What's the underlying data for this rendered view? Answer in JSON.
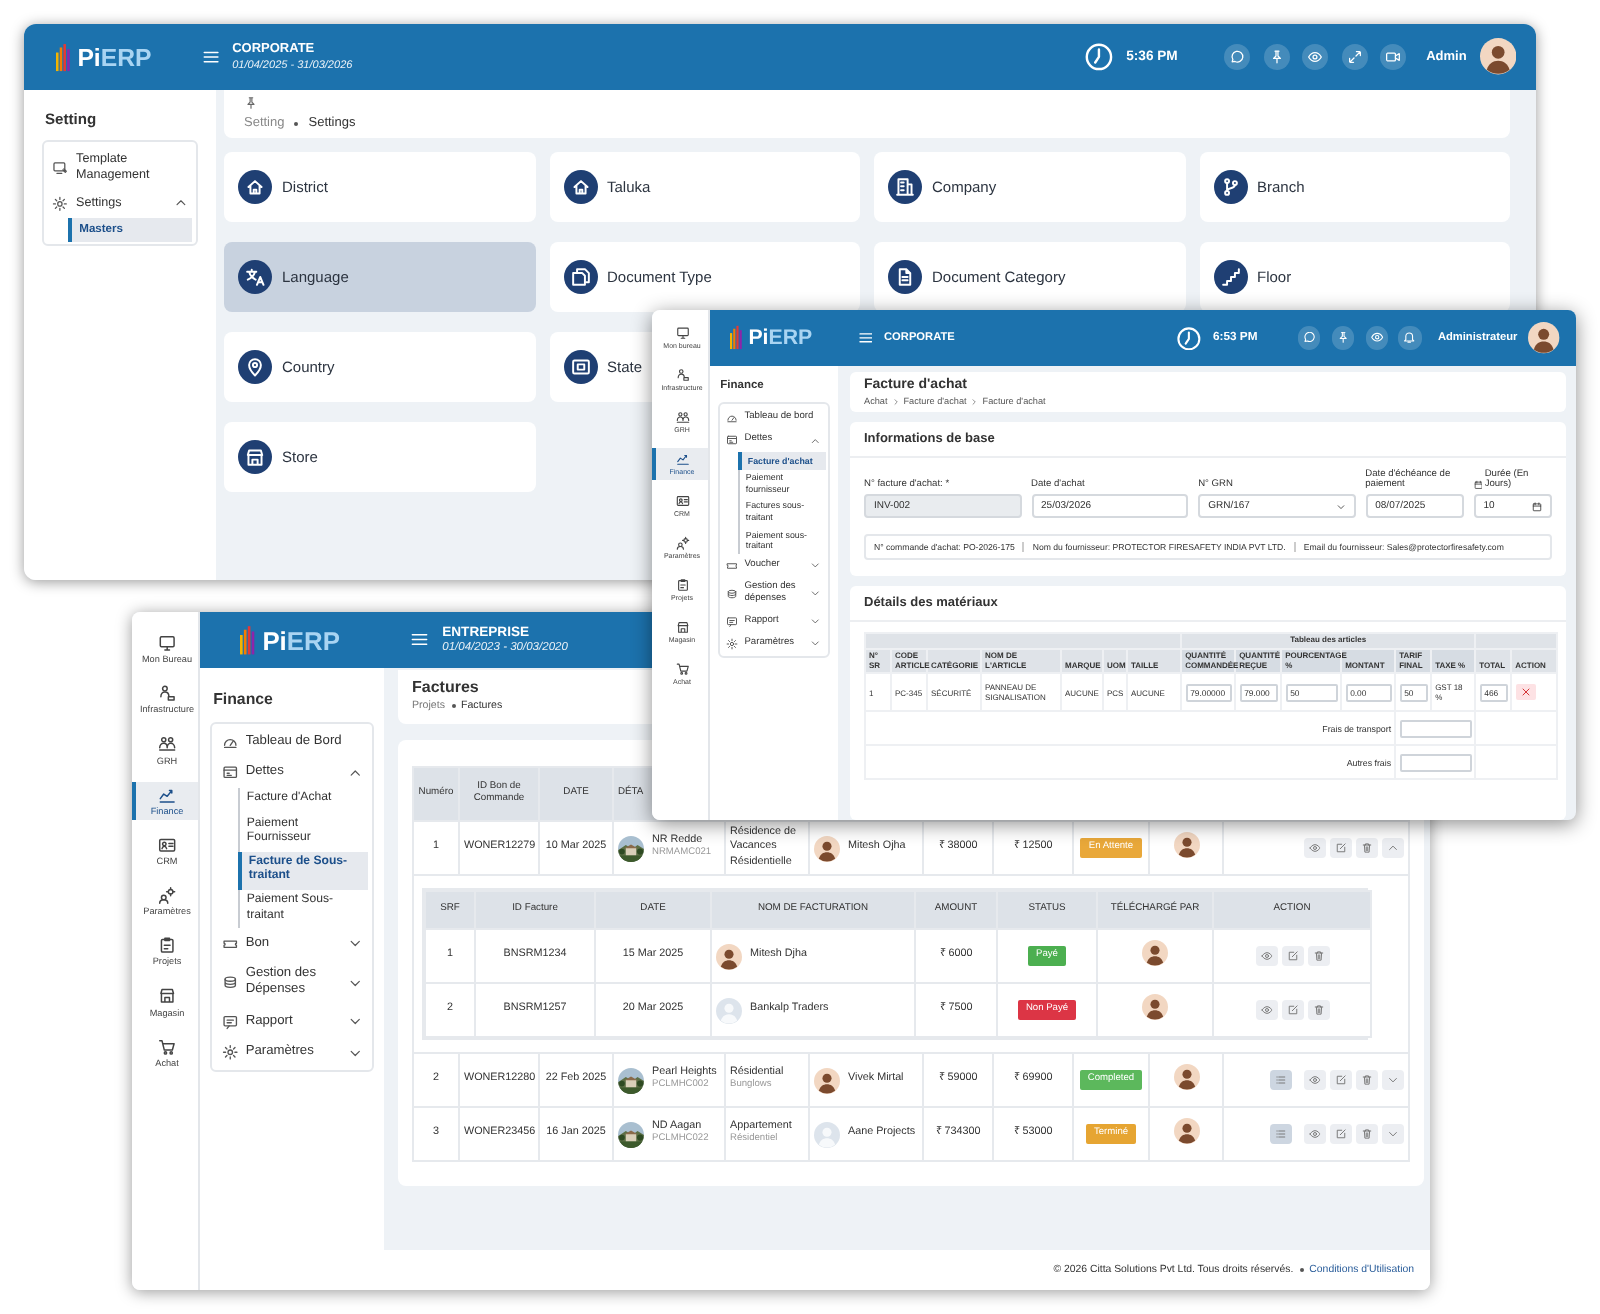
{
  "settings_window": {
    "header": {
      "brand_prefix": "Pi",
      "brand_suffix": "ERP",
      "company": "CORPORATE",
      "period": "01/04/2025 - 31/03/2026",
      "time": "5:36 PM",
      "user": "Admin"
    },
    "sidebar": {
      "title": "Setting",
      "items": [
        {
          "kind": "link",
          "label": "Template Management"
        },
        {
          "kind": "group",
          "label": "Settings",
          "expanded": true,
          "children": [
            {
              "label": "Masters",
              "selected": true
            }
          ]
        }
      ]
    },
    "breadcrumb": [
      "Setting",
      "Settings"
    ],
    "tile_rows": [
      [
        {
          "label": "District",
          "selected": false
        },
        {
          "label": "Taluka",
          "selected": false
        },
        {
          "label": "Company",
          "selected": false
        },
        {
          "label": "Branch",
          "selected": false
        }
      ],
      [
        {
          "label": "Language",
          "selected": true
        },
        {
          "label": "Document Type",
          "selected": false
        },
        {
          "label": "Document Category",
          "selected": false
        },
        {
          "label": "Floor",
          "selected": false
        }
      ],
      [
        {
          "label": "Country",
          "selected": false
        },
        {
          "label": "State",
          "selected": false
        }
      ],
      [
        {
          "label": "Store",
          "selected": false
        }
      ]
    ]
  },
  "purchase_window": {
    "rail": [
      {
        "label": "Mon bureau",
        "selected": false
      },
      {
        "label": "Infrastructure",
        "selected": false
      },
      {
        "label": "GRH",
        "selected": false
      },
      {
        "label": "Finance",
        "selected": true
      },
      {
        "label": "CRM",
        "selected": false
      },
      {
        "label": "Paramètres",
        "selected": false
      },
      {
        "label": "Projets",
        "selected": false
      },
      {
        "label": "Magasin",
        "selected": false
      },
      {
        "label": "Achat",
        "selected": false
      }
    ],
    "header": {
      "brand_prefix": "Pi",
      "brand_suffix": "ERP",
      "company": "CORPORATE",
      "time": "6:53 PM",
      "user": "Administrateur"
    },
    "sidebar": {
      "title": "Finance",
      "items": [
        {
          "kind": "link",
          "label": "Tableau de bord"
        },
        {
          "kind": "group",
          "label": "Dettes",
          "expanded": true,
          "children": [
            {
              "label": "Facture d'achat",
              "selected": true
            },
            {
              "label": "Paiement fournisseur",
              "selected": false
            },
            {
              "label": "Factures sous-traitant",
              "selected": false
            },
            {
              "label": "Paiement sous-traitant",
              "selected": false
            }
          ]
        },
        {
          "kind": "group",
          "label": "Voucher",
          "expanded": false
        },
        {
          "kind": "group",
          "label": "Gestion des dépenses",
          "expanded": false
        },
        {
          "kind": "group",
          "label": "Rapport",
          "expanded": false
        },
        {
          "kind": "group",
          "label": "Paramètres",
          "expanded": false
        }
      ]
    },
    "page": {
      "title": "Facture d'achat",
      "breadcrumb": [
        "Achat",
        "Facture d'achat",
        "Facture d'achat"
      ]
    },
    "basic_info": {
      "title": "Informations de base",
      "fields": [
        {
          "label": "N° facture d'achat: *",
          "value": "INV-002",
          "kind": "text",
          "disabled": true
        },
        {
          "label": "Date d'achat",
          "value": "25/03/2026",
          "kind": "text",
          "disabled": false
        },
        {
          "label": "N° GRN",
          "value": "GRN/167",
          "kind": "select",
          "disabled": false
        },
        {
          "label": "Date d'échéance de paiement",
          "value": "08/07/2025",
          "kind": "text",
          "disabled": false
        },
        {
          "label": "Durée (En Jours)",
          "value": "10",
          "kind": "date",
          "disabled": false
        }
      ],
      "summary": [
        "N° commande d'achat: PO-2026-175",
        "Nom du fournisseur: PROTECTOR FIRESAFETY INDIA PVT LTD.",
        "Email du fournisseur: Sales@protectorfiresafety.com"
      ]
    },
    "materials": {
      "title": "Détails des matériaux",
      "group_heading": "Tableau des articles",
      "columns": [
        {
          "label": "N° SR",
          "kind": "text",
          "in_group": false
        },
        {
          "label": "CODE ARTICLE",
          "kind": "text",
          "in_group": false
        },
        {
          "label": "CATÉGORIE",
          "kind": "text",
          "in_group": false
        },
        {
          "label": "NOM DE L'ARTICLE",
          "kind": "text",
          "in_group": false
        },
        {
          "label": "MARQUE",
          "kind": "text",
          "in_group": false
        },
        {
          "label": "UOM",
          "kind": "text",
          "in_group": false
        },
        {
          "label": "TAILLE",
          "kind": "text",
          "in_group": false
        },
        {
          "label": "QUANTITÉ COMMANDÉE",
          "kind": "input",
          "in_group": true
        },
        {
          "label": "QUANTITÉ REÇUE",
          "kind": "input",
          "in_group": true
        },
        {
          "label": "POURCENTAGE %",
          "kind": "input",
          "in_group": true
        },
        {
          "label": "MONTANT",
          "kind": "input",
          "in_group": true
        },
        {
          "label": "TARIF FINAL",
          "kind": "input",
          "in_group": true
        },
        {
          "label": "TAXE %",
          "kind": "text",
          "in_group": true
        },
        {
          "label": "TOTAL",
          "kind": "input",
          "in_group": false
        },
        {
          "label": "ACTION",
          "kind": "action",
          "in_group": false
        }
      ],
      "rows": [
        {
          "cells": [
            "1",
            "PC-345",
            "SÉCURITÉ",
            "PANNEAU DE SIGNALISATION",
            "AUCUNE",
            "PCS",
            "AUCUNE",
            "79.00000",
            "79.000",
            "50",
            "0.00",
            "50",
            "GST 18 %",
            "466"
          ]
        }
      ],
      "extras": [
        {
          "label": "Frais de transport"
        },
        {
          "label": "Autres frais"
        }
      ]
    }
  },
  "invoices_window": {
    "rail": [
      {
        "label": "Mon Bureau",
        "selected": false
      },
      {
        "label": "Infrastructure",
        "selected": false
      },
      {
        "label": "GRH",
        "selected": false
      },
      {
        "label": "Finance",
        "selected": true
      },
      {
        "label": "CRM",
        "selected": false
      },
      {
        "label": "Paramètres",
        "selected": false
      },
      {
        "label": "Projets",
        "selected": false
      },
      {
        "label": "Magasin",
        "selected": false
      },
      {
        "label": "Achat",
        "selected": false
      }
    ],
    "header": {
      "brand_prefix": "Pi",
      "brand_suffix": "ERP",
      "company": "ENTREPRISE",
      "period": "01/04/2023 - 30/03/2020"
    },
    "sidebar": {
      "title": "Finance",
      "items": [
        {
          "kind": "link",
          "label": "Tableau de Bord"
        },
        {
          "kind": "group",
          "label": "Dettes",
          "expanded": true,
          "children": [
            {
              "label": "Facture d'Achat",
              "selected": false
            },
            {
              "label": "Paiement Fournisseur",
              "selected": false
            },
            {
              "label": "Facture de Sous-traitant",
              "selected": true
            },
            {
              "label": "Paiement Sous-traitant",
              "selected": false
            }
          ]
        },
        {
          "kind": "group",
          "label": "Bon",
          "expanded": false
        },
        {
          "kind": "group",
          "label": "Gestion des Dépenses",
          "expanded": false
        },
        {
          "kind": "group",
          "label": "Rapport",
          "expanded": false
        },
        {
          "kind": "group",
          "label": "Paramètres",
          "expanded": false
        }
      ]
    },
    "page": {
      "title": "Factures",
      "breadcrumb": [
        "Projets",
        "Factures"
      ]
    },
    "table": {
      "columns": [
        "Numéro",
        "ID Bon de Commande",
        "DATE",
        "DÉTA"
      ],
      "rows": [
        {
          "number": "1",
          "order_id": "WONER12279",
          "date": "10 Mar 2025",
          "project": "NR Redde",
          "project_code": "NRMAMC021",
          "type": "Résidence de Vacances Résidentielle",
          "person": "Mitesh Ojha",
          "photo": true,
          "amount": "₹ 38000",
          "balance": "₹ 12500",
          "status": "En Attente",
          "color": "#e9a83a",
          "report_button": false,
          "expanded": true,
          "invoice_columns": [
            "SRF",
            "ID Facture",
            "DATE",
            "NOM DE FACTURATION",
            "AMOUNT",
            "STATUS",
            "TÉLÉCHARGÉ PAR",
            "ACTION"
          ],
          "invoices": [
            {
              "srf": "1",
              "id": "BNSRM1234",
              "date": "15 Mar 2025",
              "name": "Mitesh Djha",
              "photo": true,
              "amount": "₹ 6000",
              "status": "Payé",
              "color": "#4caf50"
            },
            {
              "srf": "2",
              "id": "BNSRM1257",
              "date": "20 Mar 2025",
              "name": "Bankalp Traders",
              "photo": false,
              "amount": "₹ 7500",
              "status": "Non Payé",
              "color": "#dc3545"
            }
          ]
        },
        {
          "number": "2",
          "order_id": "WONER12280",
          "date": "22 Feb 2025",
          "project": "Pearl Heights",
          "project_code": "PCLMHC002",
          "type": "Résidential",
          "type_detail": "Bunglows",
          "person": "Vivek Mirtal",
          "photo": true,
          "amount": "₹ 59000",
          "balance": "₹ 69900",
          "status": "Completed",
          "color": "#5cb85c",
          "report_button": true,
          "expanded": false
        },
        {
          "number": "3",
          "order_id": "WONER23456",
          "date": "16 Jan 2025",
          "project": "ND Aagan",
          "project_code": "PCLMHC022",
          "type": "Appartement",
          "type_detail": "Résidentiel",
          "person": "Aane Projects",
          "photo": false,
          "amount": "₹ 734300",
          "balance": "₹ 53000",
          "status": "Terminé",
          "color": "#e6a532",
          "report_button": true,
          "expanded": false
        }
      ]
    },
    "footer": {
      "copyright": "© 2026 Citta Solutions Pvt Ltd. Tous droits réservés.",
      "link": "Conditions d'Utilisation"
    }
  }
}
